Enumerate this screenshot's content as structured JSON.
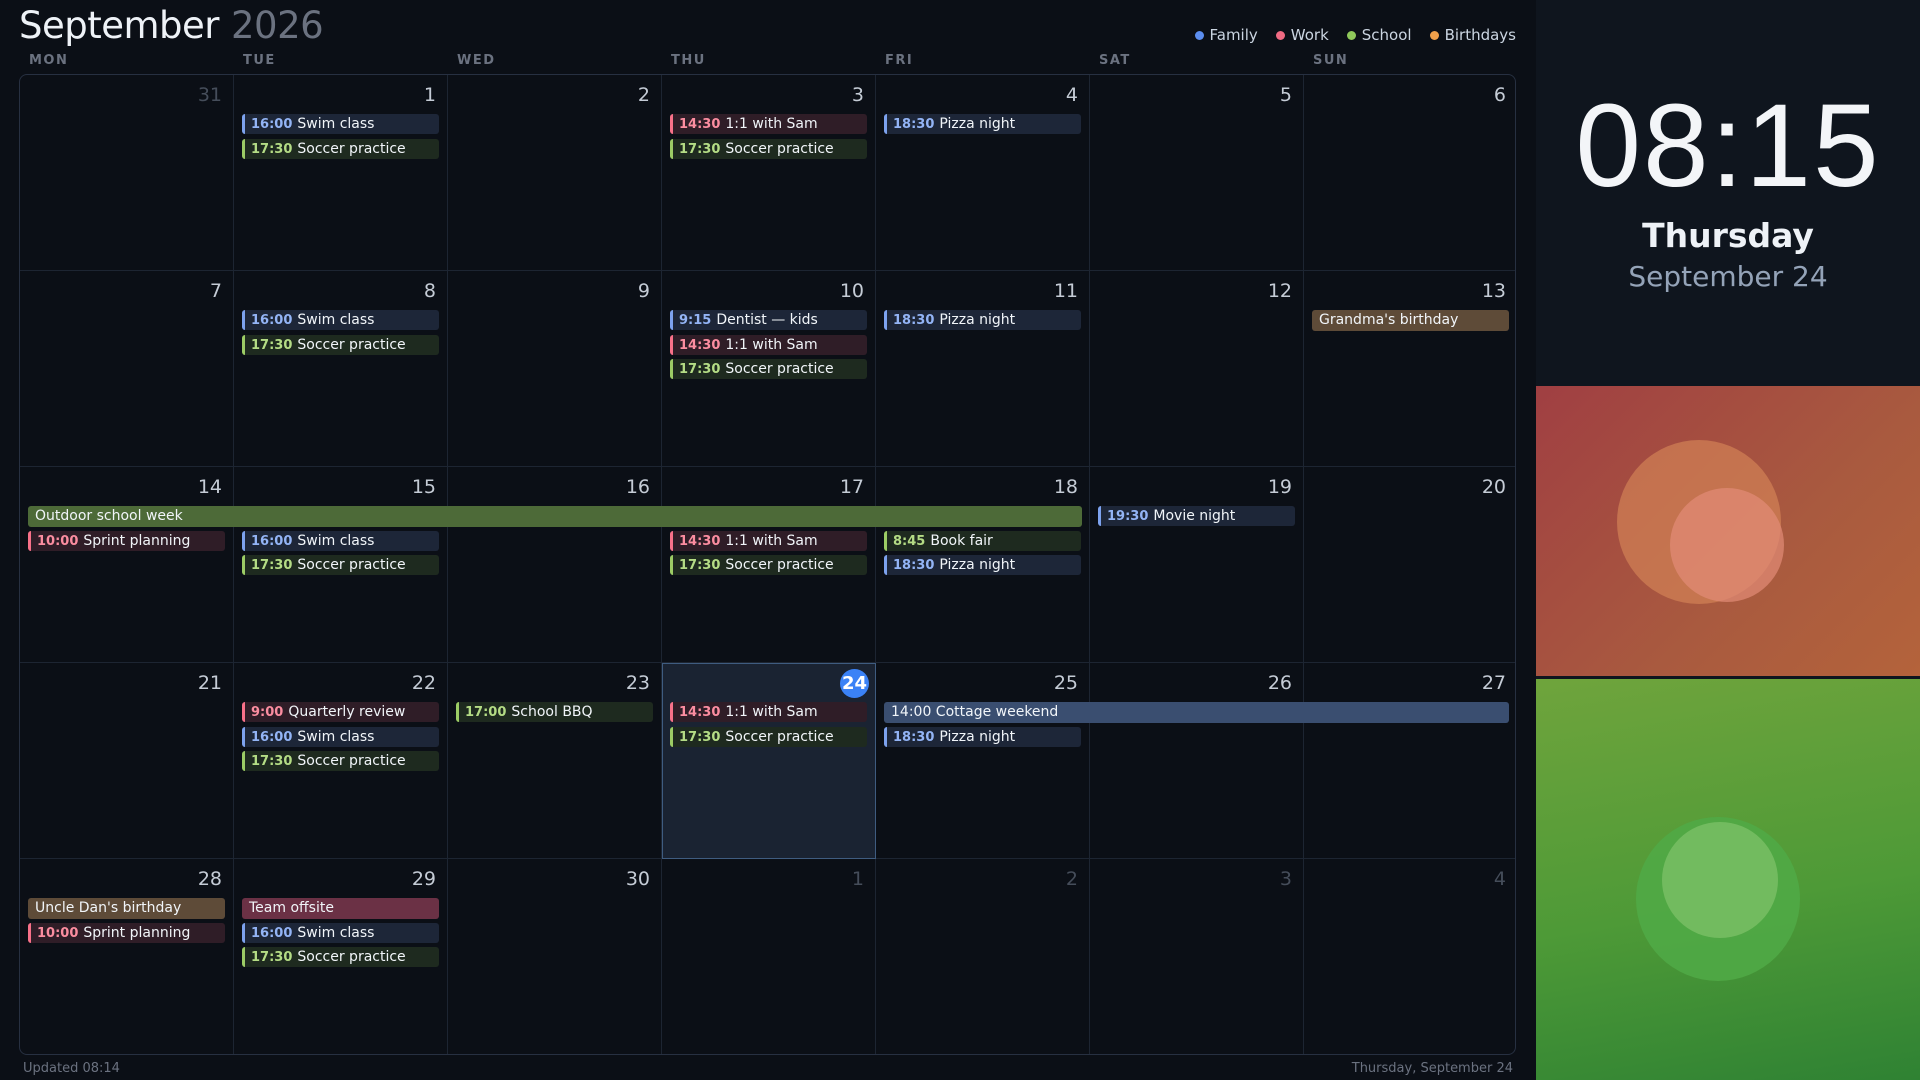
{
  "header": {
    "month": "September",
    "year": "2026"
  },
  "legend": [
    {
      "label": "Family",
      "color": "#5b8def"
    },
    {
      "label": "Work",
      "color": "#f06a82"
    },
    {
      "label": "School",
      "color": "#8fc85a"
    },
    {
      "label": "Birthdays",
      "color": "#f0a04b"
    }
  ],
  "weekdays": [
    "MON",
    "TUE",
    "WED",
    "THU",
    "FRI",
    "SAT",
    "SUN"
  ],
  "weeks": [
    [
      "31",
      "1",
      "2",
      "3",
      "4",
      "5",
      "6"
    ],
    [
      "7",
      "8",
      "9",
      "10",
      "11",
      "12",
      "13"
    ],
    [
      "14",
      "15",
      "16",
      "17",
      "18",
      "19",
      "20"
    ],
    [
      "21",
      "22",
      "23",
      "24",
      "25",
      "26",
      "27"
    ],
    [
      "28",
      "29",
      "30",
      "1",
      "2",
      "3",
      "4"
    ]
  ],
  "events": {
    "swim": {
      "time": "16:00",
      "title": "Swim class",
      "category": "family"
    },
    "soccer": {
      "time": "17:30",
      "title": "Soccer practice",
      "category": "school"
    },
    "one_on_one": {
      "time": "14:30",
      "title": "1:1 with Sam",
      "category": "work"
    },
    "pizza": {
      "time": "18:30",
      "title": "Pizza night",
      "category": "family"
    },
    "dentist": {
      "time": "9:15",
      "title": "Dentist — kids",
      "category": "family"
    },
    "sprint": {
      "time": "10:00",
      "title": "Sprint planning",
      "category": "work"
    },
    "book_fair": {
      "time": "8:45",
      "title": "Book fair",
      "category": "school"
    },
    "movie": {
      "time": "19:30",
      "title": "Movie night",
      "category": "family"
    },
    "quarterly": {
      "time": "9:00",
      "title": "Quarterly review",
      "category": "work"
    },
    "bbq": {
      "time": "17:00",
      "title": "School BBQ",
      "category": "school"
    }
  },
  "all_day": {
    "grandma": "Grandma's birthday",
    "outdoor": "Outdoor school week",
    "cottage": "14:00 Cottage weekend",
    "uncle_dan": "Uncle Dan's birthday",
    "offsite": "Team offsite"
  },
  "footer": {
    "updated": "Updated 08:14",
    "date": "Thursday, September 24"
  },
  "sidebar": {
    "time": "08:15",
    "weekday": "Thursday",
    "date": "September 24"
  }
}
